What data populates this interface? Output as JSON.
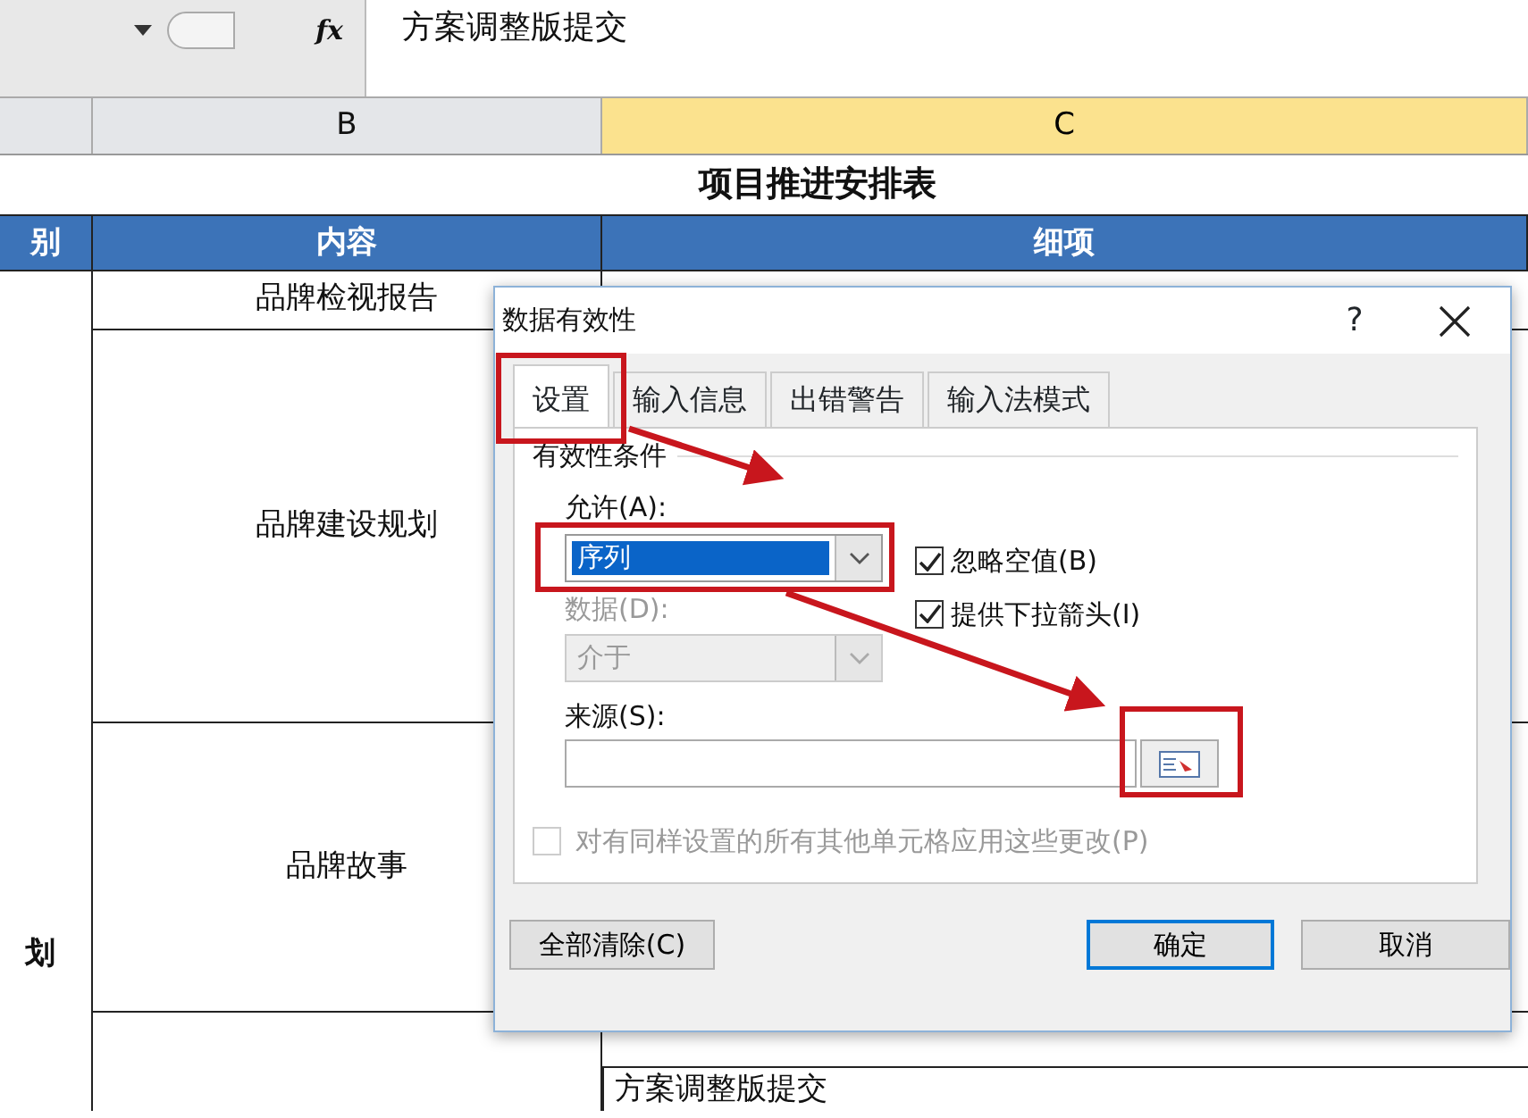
{
  "formula_bar": {
    "fx": "fx",
    "formula": "方案调整版提交"
  },
  "column_headers": [
    {
      "label": "B",
      "selected": false
    },
    {
      "label": "C",
      "selected": true
    }
  ],
  "sheet": {
    "title": "项目推进安排表",
    "header": [
      "别",
      "内容",
      "细项"
    ],
    "category": "划",
    "items": [
      "品牌检视报告",
      "品牌建设规划",
      "品牌故事"
    ],
    "detail": "方案调整版提交"
  },
  "dialog": {
    "title": "数据有效性",
    "help": "?",
    "tabs": [
      {
        "label": "设置",
        "selected": true
      },
      {
        "label": "输入信息",
        "selected": false
      },
      {
        "label": "出错警告",
        "selected": false
      },
      {
        "label": "输入法模式",
        "selected": false
      }
    ],
    "group": "有效性条件",
    "allow": {
      "label": "允许(A):",
      "value": "序列"
    },
    "options": [
      {
        "label": "忽略空值(B)",
        "checked": true
      },
      {
        "label": "提供下拉箭头(I)",
        "checked": true
      }
    ],
    "data": {
      "label": "数据(D):",
      "value": "介于",
      "disabled": true
    },
    "source": {
      "label": "来源(S):"
    },
    "apply_all": {
      "label": "对有同样设置的所有其他单元格应用这些更改(P)",
      "checked": false,
      "disabled": true
    },
    "buttons": [
      {
        "label": "全部清除(C)",
        "default": false
      },
      {
        "label": "确定",
        "default": true
      },
      {
        "label": "取消",
        "default": false
      }
    ]
  }
}
